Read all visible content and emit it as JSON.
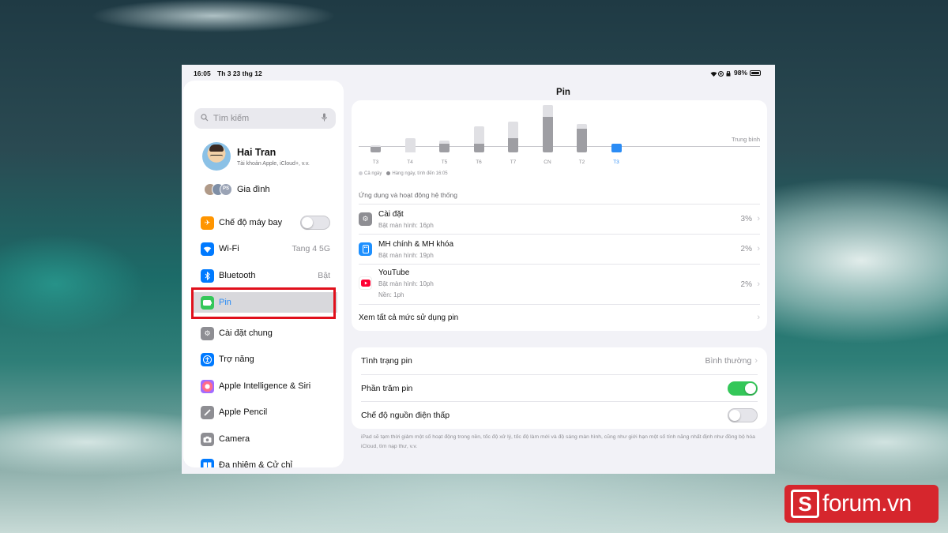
{
  "status_bar": {
    "time": "16:05",
    "date": "Th 3 23 thg 12",
    "battery": "98%"
  },
  "sidebar": {
    "search_placeholder": "Tìm kiếm",
    "profile": {
      "name": "Hai Tran",
      "subtitle": "Tài khoản Apple, iCloud+, v.v."
    },
    "family": {
      "label": "Gia đình",
      "badge": "PS"
    },
    "items": [
      {
        "label": "Chế độ máy bay",
        "toggle": false,
        "color": "#ff9500",
        "icon": "airplane-icon"
      },
      {
        "label": "Wi-Fi",
        "value": "Tang 4 5G",
        "color": "#007aff",
        "icon": "wifi-icon"
      },
      {
        "label": "Bluetooth",
        "value": "Bật",
        "color": "#007aff",
        "icon": "bluetooth-icon"
      },
      {
        "label": "Pin",
        "selected": true,
        "color": "#34c759",
        "icon": "battery-icon"
      },
      {
        "label": "Cài đặt chung",
        "color": "#8e8e93",
        "icon": "gear-icon"
      },
      {
        "label": "Trợ năng",
        "color": "#007aff",
        "icon": "accessibility-icon"
      },
      {
        "label": "Apple Intelligence & Siri",
        "color": "#ff6b8a",
        "icon": "siri-icon"
      },
      {
        "label": "Apple Pencil",
        "color": "#8e8e93",
        "icon": "pencil-icon"
      },
      {
        "label": "Camera",
        "color": "#8e8e93",
        "icon": "camera-icon"
      },
      {
        "label": "Đa nhiệm & Cử chỉ",
        "color": "#007aff",
        "icon": "multitasking-icon"
      }
    ]
  },
  "main": {
    "title": "Pin",
    "chart": {
      "average_label": "Trung bình",
      "legend": [
        "Cả ngày",
        "Hàng ngày, tính đến 16:05"
      ],
      "days": [
        "T3",
        "T4",
        "T5",
        "T6",
        "T7",
        "CN",
        "T2",
        "T3"
      ],
      "current_index": 7
    },
    "section_title": "Ứng dụng và hoạt động hệ thống",
    "apps": [
      {
        "name": "Cài đặt",
        "detail": "Bật màn hình: 16ph",
        "percent": "3%",
        "color": "#8e8e93",
        "icon": "gear-icon"
      },
      {
        "name": "MH chính & MH khóa",
        "detail": "Bật màn hình: 19ph",
        "percent": "2%",
        "color": "#1e90ff",
        "icon": "home-screen-icon"
      },
      {
        "name": "YouTube",
        "detail": "Bật màn hình: 10ph",
        "detail2": "Nền: 1ph",
        "percent": "2%",
        "color": "#ff0033",
        "icon": "youtube-icon"
      }
    ],
    "see_all": "Xem tất cả mức sử dụng pin",
    "settings": {
      "health": {
        "label": "Tình trạng pin",
        "value": "Bình thường"
      },
      "percentage": {
        "label": "Phần trăm pin",
        "on": true
      },
      "low_power": {
        "label": "Chế độ nguồn điện thấp",
        "on": false
      }
    },
    "footnote": "iPad sẽ tạm thời giảm một số hoạt động trong nền, tốc độ xử lý, tốc độ làm mới và độ sáng màn hình, cũng như giới hạn một số tính năng nhất định như đồng bộ hóa iCloud, tìm nạp thư, v.v."
  },
  "chart_data": {
    "type": "bar",
    "categories": [
      "T3",
      "T4",
      "T5",
      "T6",
      "T7",
      "CN",
      "T2",
      "T3"
    ],
    "series": [
      {
        "name": "Cả ngày",
        "values": [
          0.15,
          0.3,
          0.25,
          0.55,
          0.65,
          1.0,
          0.6,
          0
        ]
      },
      {
        "name": "Hàng ngày, tính đến 16:05",
        "values": [
          0.12,
          0.0,
          0.18,
          0.18,
          0.3,
          0.75,
          0.5,
          0.18
        ]
      }
    ],
    "average_label": "Trung bình"
  },
  "watermark": {
    "text": "forum.vn",
    "letter": "S",
    "color": "#d6262d"
  }
}
